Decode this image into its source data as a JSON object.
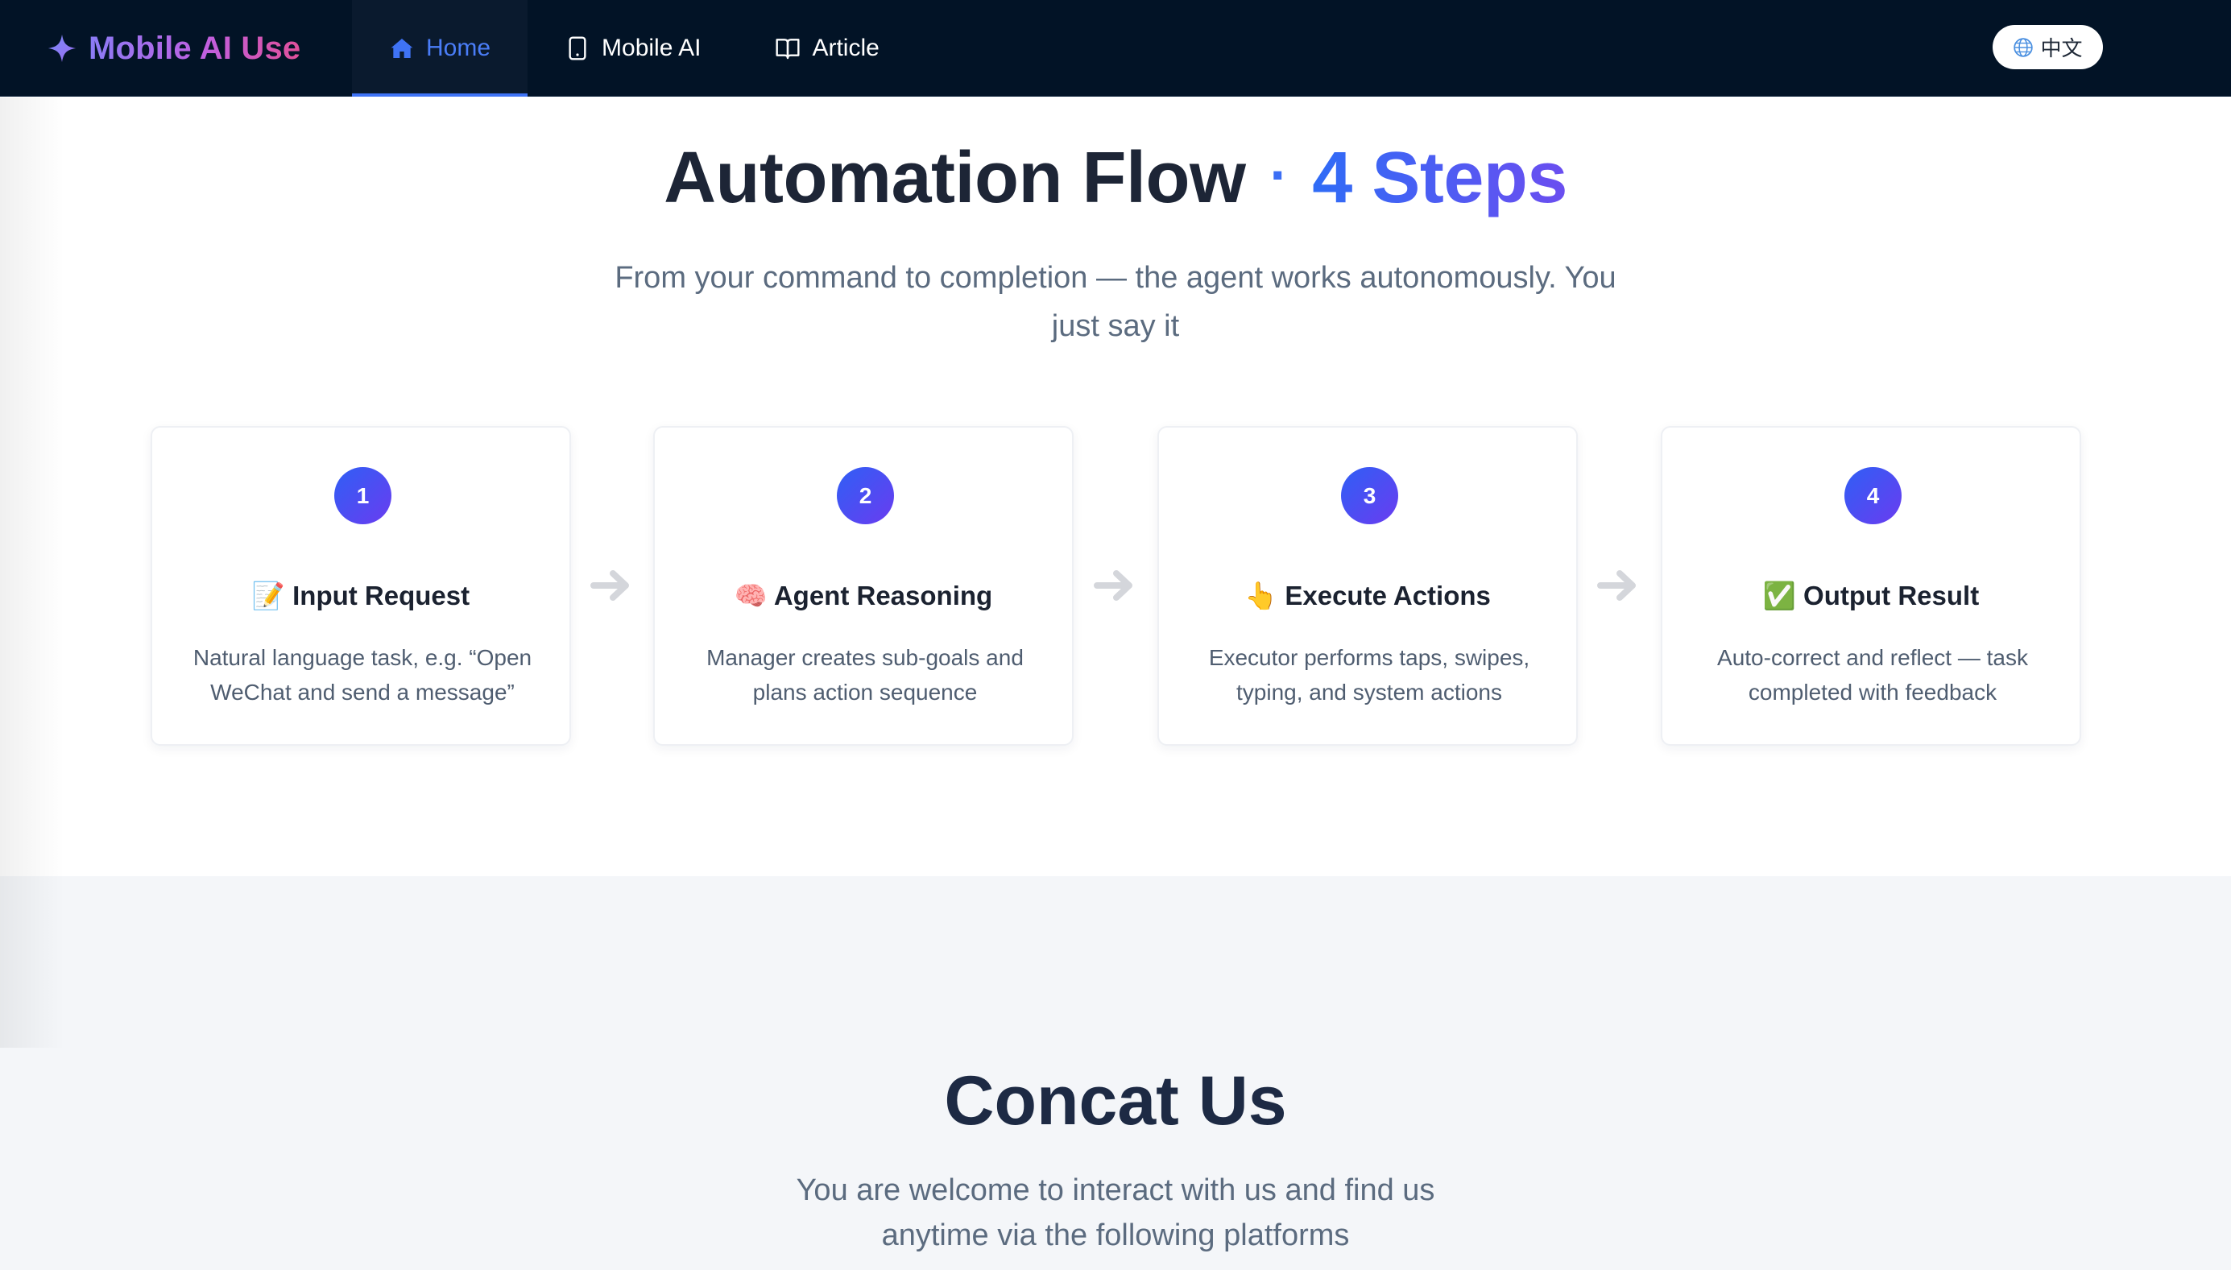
{
  "nav": {
    "brand": "Mobile AI Use",
    "tabs": [
      {
        "label": "Home",
        "icon": "home-icon",
        "active": true
      },
      {
        "label": "Mobile AI",
        "icon": "mobile-icon",
        "active": false
      },
      {
        "label": "Article",
        "icon": "book-icon",
        "active": false
      }
    ],
    "language": "中文"
  },
  "flow": {
    "title_main": "Automation Flow",
    "title_separator": "·",
    "title_accent": "4 Steps",
    "subtitle": "From your command to completion — the agent works autonomously. You just say it",
    "steps": [
      {
        "number": "1",
        "emoji": "📝",
        "title": "Input Request",
        "description": "Natural language task, e.g. “Open WeChat and send a message”"
      },
      {
        "number": "2",
        "emoji": "🧠",
        "title": "Agent Reasoning",
        "description": "Manager creates sub-goals and plans action sequence"
      },
      {
        "number": "3",
        "emoji": "👆",
        "title": "Execute Actions",
        "description": "Executor performs taps, swipes, typing, and system actions"
      },
      {
        "number": "4",
        "emoji": "✅",
        "title": "Output Result",
        "description": "Auto-correct and reflect — task completed with feedback"
      }
    ]
  },
  "contact": {
    "title": "Concat Us",
    "subtitle": "You are welcome to interact with us and find us anytime via the following platforms"
  },
  "colors": {
    "nav_bg": "#021326",
    "accent_blue": "#3b6ef5",
    "accent_purple": "#6a3cf0",
    "brand_gradient_start": "#8b7cf6",
    "brand_gradient_end": "#e0509a",
    "contact_bg": "#f4f6f9"
  }
}
